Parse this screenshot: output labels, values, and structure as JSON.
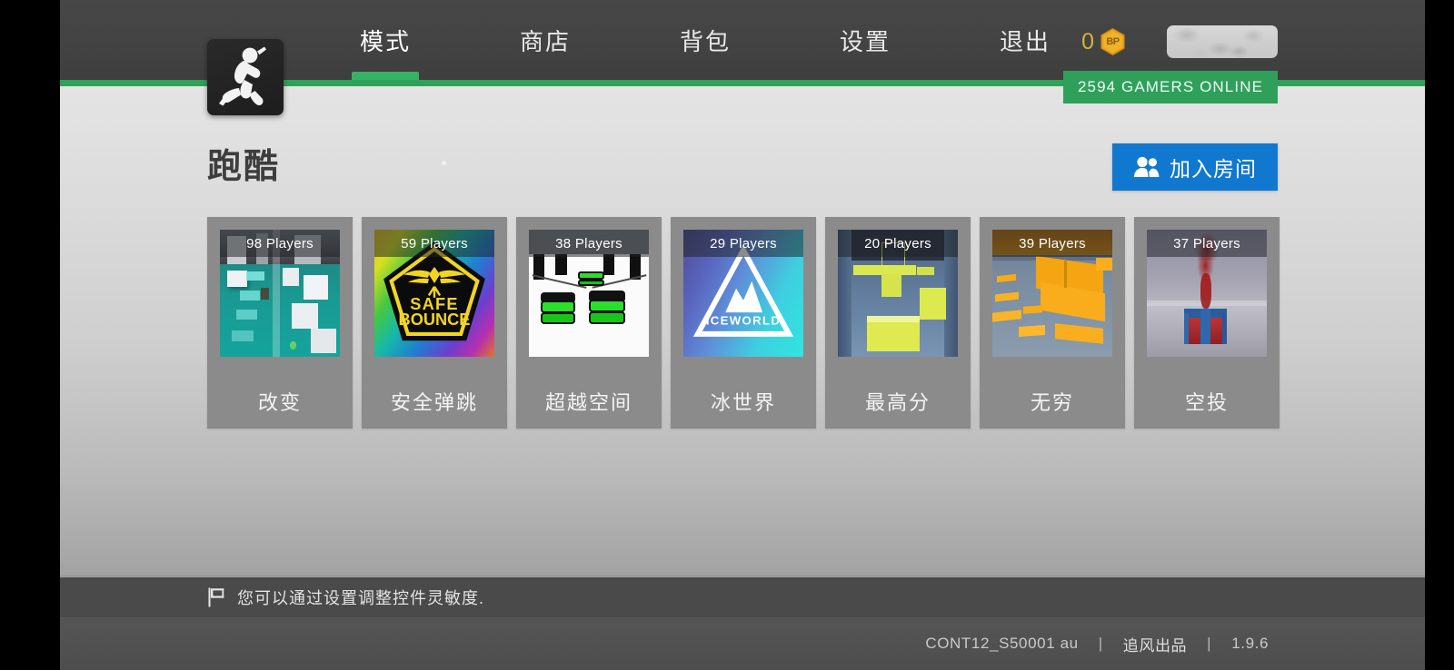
{
  "header": {
    "logo_icon": "running-man-icon",
    "nav": [
      {
        "label": "模式",
        "active": true
      },
      {
        "label": "商店",
        "active": false
      },
      {
        "label": "背包",
        "active": false
      },
      {
        "label": "设置",
        "active": false
      },
      {
        "label": "退出",
        "active": false
      }
    ],
    "currency": {
      "value": "0",
      "icon": "bp-coin-icon",
      "coin_label": "BP"
    },
    "online_banner": "2594 GAMERS ONLINE",
    "accent_green": "#2fa05a",
    "coin_gold": "#e9a81a"
  },
  "main": {
    "page_title": "跑酷",
    "join_button": {
      "label": "加入房间",
      "icon": "two-people-icon",
      "color": "#1178cf"
    },
    "cards": [
      {
        "name": "改变",
        "players": "98 Players",
        "thumb": "teal-water-white-cubes"
      },
      {
        "name": "安全弹跳",
        "players": "59 Players",
        "thumb": "safe-bounce-badge",
        "badge_line1": "SAFE",
        "badge_line2": "BOUNCE"
      },
      {
        "name": "超越空间",
        "players": "38 Players",
        "thumb": "white-room-green-platforms"
      },
      {
        "name": "冰世界",
        "players": "29 Players",
        "thumb": "iceworld-mountain",
        "badge_text": "ICEWORLD"
      },
      {
        "name": "最高分",
        "players": "20 Players",
        "thumb": "blue-room-yellow-blocks"
      },
      {
        "name": "无穷",
        "players": "39 Players",
        "thumb": "orange-platforms"
      },
      {
        "name": "空投",
        "players": "37 Players",
        "thumb": "red-supply-crate-smoke"
      }
    ]
  },
  "tip_bar": {
    "icon": "flag-icon",
    "text": "您可以通过设置调整控件灵敏度."
  },
  "footer": {
    "server": "CONT12_S50001 au",
    "separator": "|",
    "publisher": "追风出品",
    "version": "1.9.6"
  }
}
